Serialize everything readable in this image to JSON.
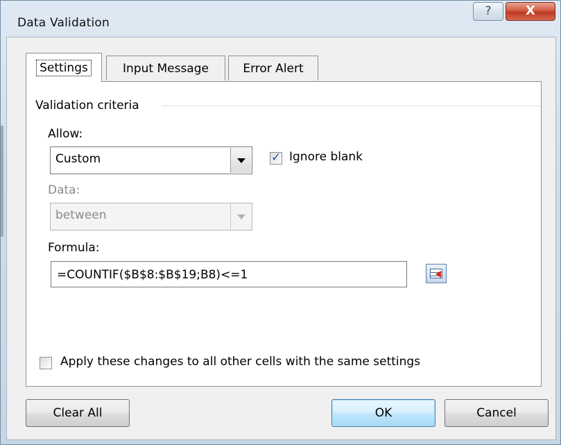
{
  "window": {
    "title": "Data Validation",
    "help_glyph": "?",
    "close_glyph": "X"
  },
  "tabs": [
    {
      "label": "Settings",
      "active": true
    },
    {
      "label": "Input Message",
      "active": false
    },
    {
      "label": "Error Alert",
      "active": false
    }
  ],
  "settings": {
    "group_label": "Validation criteria",
    "allow": {
      "label": "Allow:",
      "value": "Custom"
    },
    "ignore_blank": {
      "label": "Ignore blank",
      "checked": true
    },
    "data": {
      "label": "Data:",
      "value": "between",
      "enabled": false
    },
    "formula": {
      "label": "Formula:",
      "value": "=COUNTIF($B$8:$B$19;B8)<=1"
    },
    "apply_all": {
      "label": "Apply these changes to all other cells with the same settings",
      "checked": false
    }
  },
  "buttons": {
    "clear_all": "Clear All",
    "ok": "OK",
    "cancel": "Cancel"
  },
  "colors": {
    "accent": "#3c7fb1",
    "close": "#c03a22",
    "disabled_text": "#8a8a8a"
  }
}
